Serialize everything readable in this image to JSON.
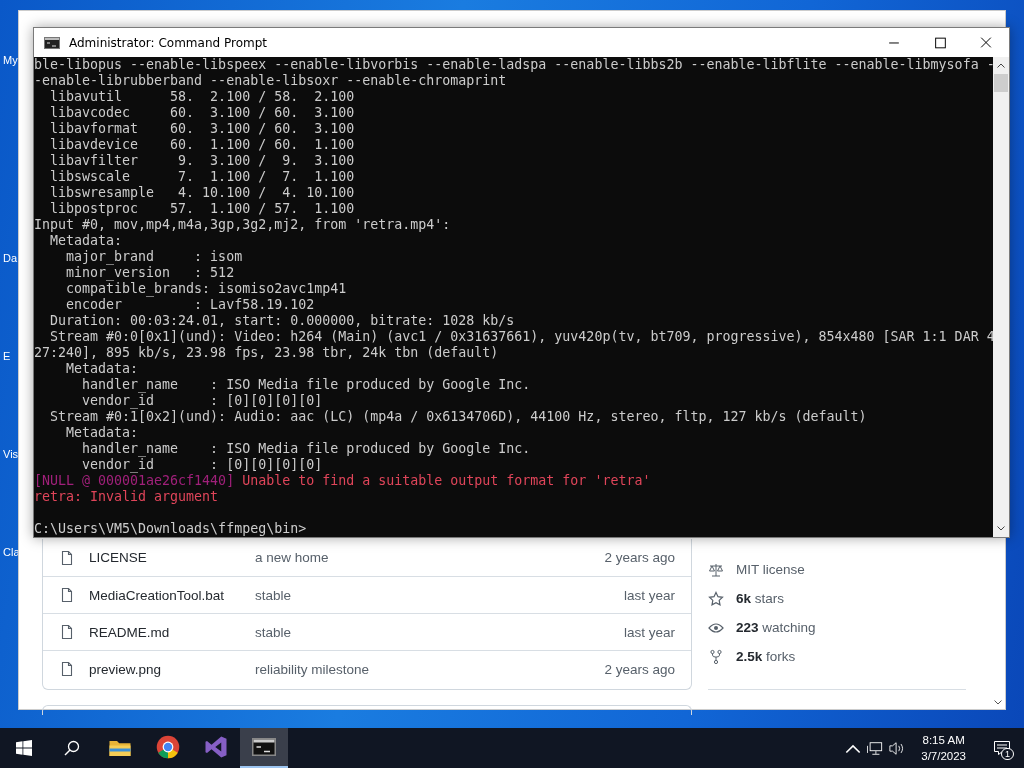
{
  "desktop_icons": [
    {
      "label": "My"
    },
    {
      "label": "Da"
    },
    {
      "label": "E"
    },
    {
      "label": "Vis"
    },
    {
      "label": "Cla"
    }
  ],
  "browser": {
    "files": [
      {
        "name": "LICENSE",
        "message": "a new home",
        "time": "2 years ago"
      },
      {
        "name": "MediaCreationTool.bat",
        "message": "stable",
        "time": "last year"
      },
      {
        "name": "README.md",
        "message": "stable",
        "time": "last year"
      },
      {
        "name": "preview.png",
        "message": "reliability milestone",
        "time": "2 years ago"
      }
    ],
    "about": [
      {
        "kind": "license",
        "text": "MIT license"
      },
      {
        "kind": "stars",
        "text": "**6k** stars"
      },
      {
        "kind": "watching",
        "text": "**223** watching"
      },
      {
        "kind": "forks",
        "text": "**2.5k** forks"
      }
    ]
  },
  "console_window": {
    "title": "Administrator:  Command Prompt",
    "lines": [
      {
        "text": "ble-libopus --enable-libspeex --enable-libvorbis --enable-ladspa --enable-libbs2b --enable-libflite --enable-libmysofa -"
      },
      {
        "text": "-enable-librubberband --enable-libsoxr --enable-chromaprint"
      },
      {
        "text": "  libavutil      58.  2.100 / 58.  2.100"
      },
      {
        "text": "  libavcodec     60.  3.100 / 60.  3.100"
      },
      {
        "text": "  libavformat    60.  3.100 / 60.  3.100"
      },
      {
        "text": "  libavdevice    60.  1.100 / 60.  1.100"
      },
      {
        "text": "  libavfilter     9.  3.100 /  9.  3.100"
      },
      {
        "text": "  libswscale      7.  1.100 /  7.  1.100"
      },
      {
        "text": "  libswresample   4. 10.100 /  4. 10.100"
      },
      {
        "text": "  libpostproc    57.  1.100 / 57.  1.100"
      },
      {
        "text": "Input #0, mov,mp4,m4a,3gp,3g2,mj2, from 'retra.mp4':"
      },
      {
        "text": "  Metadata:"
      },
      {
        "text": "    major_brand     : isom"
      },
      {
        "text": "    minor_version   : 512"
      },
      {
        "text": "    compatible_brands: isomiso2avc1mp41"
      },
      {
        "text": "    encoder         : Lavf58.19.102"
      },
      {
        "text": "  Duration: 00:03:24.01, start: 0.000000, bitrate: 1028 kb/s"
      },
      {
        "text": "  Stream #0:0[0x1](und): Video: h264 (Main) (avc1 / 0x31637661), yuv420p(tv, bt709, progressive), 854x480 [SAR 1:1 DAR 4"
      },
      {
        "text": "27:240], 895 kb/s, 23.98 fps, 23.98 tbr, 24k tbn (default)"
      },
      {
        "text": "    Metadata:"
      },
      {
        "text": "      handler_name    : ISO Media file produced by Google Inc."
      },
      {
        "text": "      vendor_id       : [0][0][0][0]"
      },
      {
        "text": "  Stream #0:1[0x2](und): Audio: aac (LC) (mp4a / 0x6134706D), 44100 Hz, stereo, fltp, 127 kb/s (default)"
      },
      {
        "text": "    Metadata:"
      },
      {
        "text": "      handler_name    : ISO Media file produced by Google Inc."
      },
      {
        "text": "      vendor_id       : [0][0][0][0]"
      },
      {
        "kind": "error",
        "segments": [
          {
            "text": "[NULL @ 000001ae26cf1440]",
            "color": "#a0207a"
          },
          {
            "text": " Unable to find a suitable output format for 'retra'",
            "color": "#e0455a"
          }
        ]
      },
      {
        "kind": "error",
        "segments": [
          {
            "text": "retra: Invalid argument",
            "color": "#e0455a"
          }
        ]
      },
      {
        "kind": "prompt",
        "text": "C:\\Users\\VM5\\Downloads\\ffmpeg\\bin>"
      }
    ]
  },
  "taskbar": {
    "apps": [
      {
        "kind": "explorer",
        "selected": false
      },
      {
        "kind": "browser",
        "selected": false
      },
      {
        "kind": "studio",
        "selected": false
      },
      {
        "kind": "terminal",
        "selected": true
      }
    ],
    "time": "8:15 AM",
    "date": "3/7/2023",
    "notifications": "1"
  }
}
